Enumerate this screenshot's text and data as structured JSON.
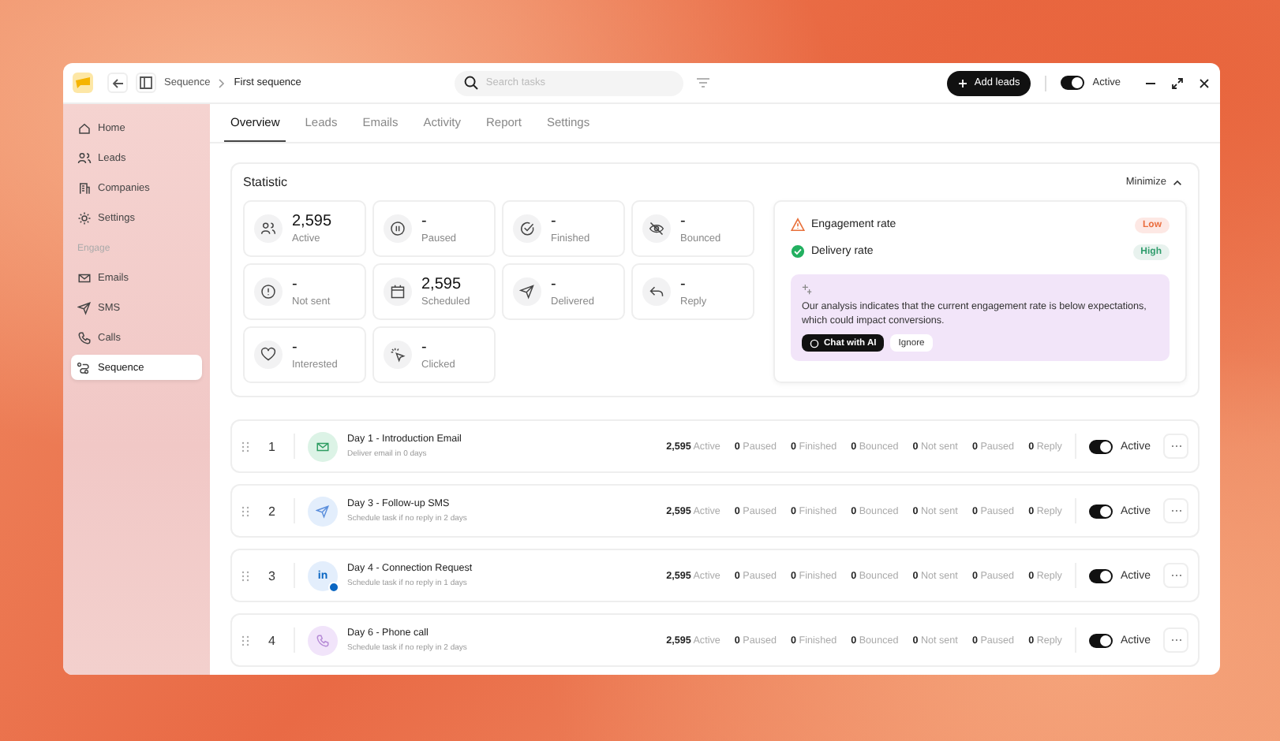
{
  "breadcrumb": [
    "Sequence",
    "First sequence"
  ],
  "search": {
    "placeholder": "Search tasks"
  },
  "add_button": "Add leads",
  "header_toggle": {
    "label": "Active",
    "on": true
  },
  "sidebar": {
    "items": [
      {
        "label": "Home",
        "selected": false
      },
      {
        "label": "Leads",
        "selected": false
      },
      {
        "label": "Companies",
        "selected": false
      },
      {
        "label": "Settings",
        "selected": false
      }
    ],
    "section": "Engage",
    "engage_items": [
      {
        "label": "Emails",
        "selected": false
      },
      {
        "label": "SMS",
        "selected": false
      },
      {
        "label": "Calls",
        "selected": false
      },
      {
        "label": "Sequence",
        "selected": true
      }
    ]
  },
  "tabs": [
    {
      "label": "Overview",
      "selected": true
    },
    {
      "label": "Leads",
      "selected": false
    },
    {
      "label": "Emails",
      "selected": false
    },
    {
      "label": "Activity",
      "selected": false
    },
    {
      "label": "Report",
      "selected": false
    },
    {
      "label": "Settings",
      "selected": false
    }
  ],
  "statistic": {
    "title": "Statistic",
    "minimize": "Minimize",
    "stats": [
      {
        "value": "2,595",
        "label": "Active"
      },
      {
        "value": "-",
        "label": "Paused"
      },
      {
        "value": "-",
        "label": "Finished"
      },
      {
        "value": "-",
        "label": "Bounced"
      },
      {
        "value": "-",
        "label": "Not sent"
      },
      {
        "value": "2,595",
        "label": "Scheduled"
      },
      {
        "value": "-",
        "label": "Delivered"
      },
      {
        "value": "-",
        "label": "Reply"
      },
      {
        "value": "-",
        "label": "Interested"
      },
      {
        "value": "-",
        "label": "Clicked"
      }
    ],
    "rates": [
      {
        "kind": "warning",
        "label": "Engagement rate",
        "badge": "Low"
      },
      {
        "kind": "success",
        "label": "Delivery rate",
        "badge": "High"
      }
    ],
    "ai": {
      "text": "Our analysis indicates that the current engagement rate is below expectations, which could impact conversions.",
      "primary": "Chat with AI",
      "secondary": "Ignore"
    }
  },
  "steps": [
    {
      "number": "1",
      "title": "Day 1 - Introduction Email",
      "subtitle": "Deliver email in 0 days",
      "metrics": [
        "**2,595** Active",
        "**0** Paused",
        "**0** Finished",
        "**0** Bounced",
        "**0** Not sent",
        "**0** Paused",
        "**0** Reply"
      ],
      "toggle": {
        "on": true,
        "label": "Active"
      }
    },
    {
      "number": "2",
      "title": "Day 3 - Follow-up SMS",
      "subtitle": "Schedule task if no reply in 2 days",
      "metrics": [
        "**2,595** Active",
        "**0** Paused",
        "**0** Finished",
        "**0** Bounced",
        "**0** Not sent",
        "**0** Paused",
        "**0** Reply"
      ],
      "toggle": {
        "on": true,
        "label": "Active"
      }
    },
    {
      "number": "3",
      "title": "Day 4 - Connection Request",
      "subtitle": "Schedule task if no reply in 1 days",
      "icon_text": "in",
      "metrics": [
        "**2,595** Active",
        "**0** Paused",
        "**0** Finished",
        "**0** Bounced",
        "**0** Not sent",
        "**0** Paused",
        "**0** Reply"
      ],
      "toggle": {
        "on": true,
        "label": "Active"
      }
    },
    {
      "number": "4",
      "title": "Day 6 - Phone call",
      "subtitle": "Schedule task if no reply in 2 days",
      "metrics": [
        "**2,595** Active",
        "**0** Paused",
        "**0** Finished",
        "**0** Bounced",
        "**0** Not sent",
        "**0** Paused",
        "**0** Reply"
      ],
      "toggle": {
        "on": true,
        "label": "Active"
      }
    }
  ]
}
